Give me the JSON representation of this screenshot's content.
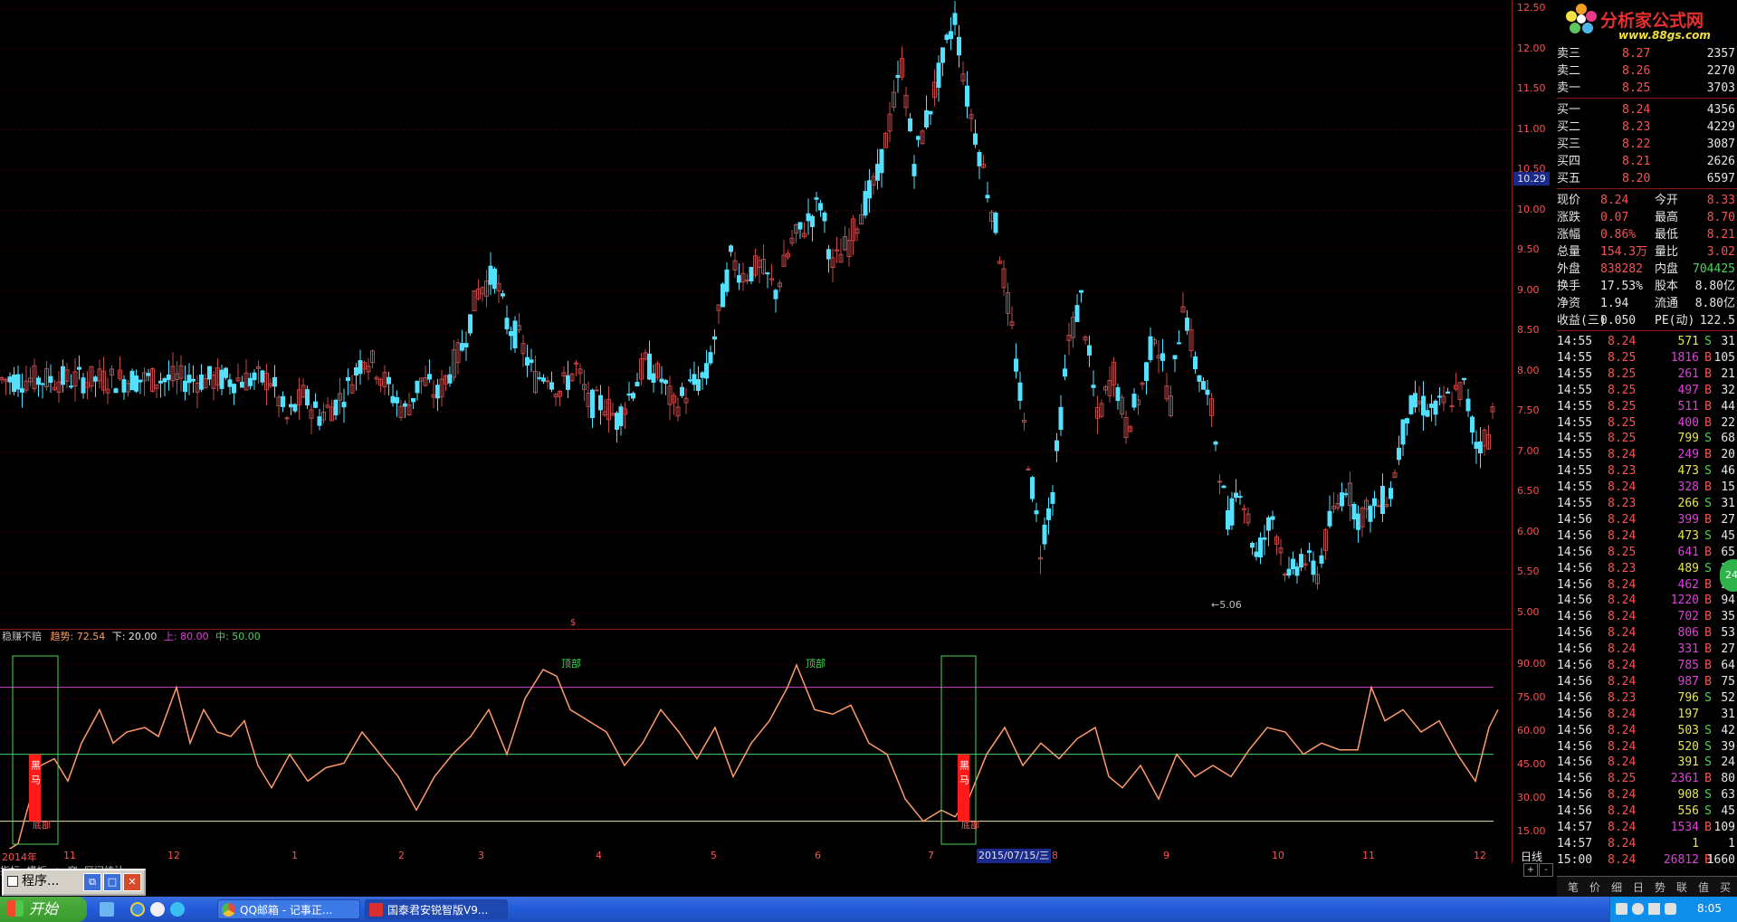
{
  "price_axis": {
    "labels": [
      "12.50",
      "12.00",
      "11.50",
      "11.00",
      "10.50",
      "10.00",
      "9.50",
      "9.00",
      "8.50",
      "8.00",
      "7.50",
      "7.00",
      "6.50",
      "6.00",
      "5.50",
      "5.00"
    ],
    "current_marker": "10.29",
    "min_marker": "5.06"
  },
  "indicator": {
    "name": "稳赚不赔",
    "trend_label": "趋势: 72.54",
    "lower_label": "下: 20.00",
    "upper_label": "上: 80.00",
    "mid_label": "中: 50.00",
    "axis_labels": [
      "90.00",
      "75.00",
      "60.00",
      "45.00",
      "30.00",
      "15.00"
    ],
    "top_tag": "顶部",
    "signal_tag": "黑马",
    "signal_sub": "底部",
    "header_mark": "$"
  },
  "time_axis": {
    "labels": [
      "2014年",
      "11",
      "12",
      "1",
      "2",
      "3",
      "4",
      "5",
      "6",
      "7",
      "8",
      "9",
      "10",
      "11",
      "12"
    ],
    "cursor_date": "2015/07/15/三",
    "period": "日线"
  },
  "status_bar": {
    "items": [
      "指标",
      "模板",
      "∧",
      "窗",
      "区间统计"
    ]
  },
  "logo": {
    "title": "分析家公式网",
    "url": "www.88gs.com"
  },
  "order_book": {
    "asks": [
      {
        "label": "卖三",
        "price": "8.27",
        "vol": "2357"
      },
      {
        "label": "卖二",
        "price": "8.26",
        "vol": "2270"
      },
      {
        "label": "卖一",
        "price": "8.25",
        "vol": "3703"
      }
    ],
    "bids": [
      {
        "label": "买一",
        "price": "8.24",
        "vol": "4356"
      },
      {
        "label": "买二",
        "price": "8.23",
        "vol": "4229"
      },
      {
        "label": "买三",
        "price": "8.22",
        "vol": "3087"
      },
      {
        "label": "买四",
        "price": "8.21",
        "vol": "2626"
      },
      {
        "label": "买五",
        "price": "8.20",
        "vol": "6597"
      }
    ]
  },
  "quote": [
    {
      "l1": "现价",
      "v1": "8.24",
      "l2": "今开",
      "v2": "8.33"
    },
    {
      "l1": "涨跌",
      "v1": "0.07",
      "l2": "最高",
      "v2": "8.70"
    },
    {
      "l1": "涨幅",
      "v1": "0.86%",
      "l2": "最低",
      "v2": "8.21"
    },
    {
      "l1": "总量",
      "v1": "154.3万",
      "l2": "量比",
      "v2": "3.02"
    },
    {
      "l1": "外盘",
      "v1": "838282",
      "l2": "内盘",
      "v2": "704425"
    },
    {
      "l1": "换手",
      "v1": "17.53%",
      "l2": "股本",
      "v2": "8.80亿"
    },
    {
      "l1": "净资",
      "v1": "1.94",
      "l2": "流通",
      "v2": "8.80亿"
    },
    {
      "l1": "收益(三)",
      "v1": "0.050",
      "l2": "PE(动)",
      "v2": "122.5"
    }
  ],
  "ticks": [
    {
      "t": "14:55",
      "p": "8.24",
      "v": "571",
      "d": "S",
      "n": "31"
    },
    {
      "t": "14:55",
      "p": "8.25",
      "v": "1816",
      "d": "B",
      "n": "105"
    },
    {
      "t": "14:55",
      "p": "8.25",
      "v": "261",
      "d": "B",
      "n": "21"
    },
    {
      "t": "14:55",
      "p": "8.25",
      "v": "497",
      "d": "B",
      "n": "32"
    },
    {
      "t": "14:55",
      "p": "8.25",
      "v": "511",
      "d": "B",
      "n": "44"
    },
    {
      "t": "14:55",
      "p": "8.25",
      "v": "400",
      "d": "B",
      "n": "22"
    },
    {
      "t": "14:55",
      "p": "8.25",
      "v": "799",
      "d": "S",
      "n": "68"
    },
    {
      "t": "14:55",
      "p": "8.24",
      "v": "249",
      "d": "B",
      "n": "20"
    },
    {
      "t": "14:55",
      "p": "8.23",
      "v": "473",
      "d": "S",
      "n": "46"
    },
    {
      "t": "14:55",
      "p": "8.24",
      "v": "328",
      "d": "B",
      "n": "15"
    },
    {
      "t": "14:55",
      "p": "8.23",
      "v": "266",
      "d": "S",
      "n": "31"
    },
    {
      "t": "14:56",
      "p": "8.24",
      "v": "399",
      "d": "B",
      "n": "27"
    },
    {
      "t": "14:56",
      "p": "8.24",
      "v": "473",
      "d": "S",
      "n": "45"
    },
    {
      "t": "14:56",
      "p": "8.25",
      "v": "641",
      "d": "B",
      "n": "65"
    },
    {
      "t": "14:56",
      "p": "8.23",
      "v": "489",
      "d": "S",
      "n": "21"
    },
    {
      "t": "14:56",
      "p": "8.24",
      "v": "462",
      "d": "B",
      "n": "24"
    },
    {
      "t": "14:56",
      "p": "8.24",
      "v": "1220",
      "d": "B",
      "n": "94"
    },
    {
      "t": "14:56",
      "p": "8.24",
      "v": "702",
      "d": "B",
      "n": "35"
    },
    {
      "t": "14:56",
      "p": "8.24",
      "v": "806",
      "d": "B",
      "n": "53"
    },
    {
      "t": "14:56",
      "p": "8.24",
      "v": "331",
      "d": "B",
      "n": "27"
    },
    {
      "t": "14:56",
      "p": "8.24",
      "v": "785",
      "d": "B",
      "n": "64"
    },
    {
      "t": "14:56",
      "p": "8.24",
      "v": "987",
      "d": "B",
      "n": "75"
    },
    {
      "t": "14:56",
      "p": "8.23",
      "v": "796",
      "d": "S",
      "n": "52"
    },
    {
      "t": "14:56",
      "p": "8.24",
      "v": "197",
      "d": "",
      "n": "31"
    },
    {
      "t": "14:56",
      "p": "8.24",
      "v": "503",
      "d": "S",
      "n": "42"
    },
    {
      "t": "14:56",
      "p": "8.24",
      "v": "520",
      "d": "S",
      "n": "39"
    },
    {
      "t": "14:56",
      "p": "8.24",
      "v": "391",
      "d": "S",
      "n": "24"
    },
    {
      "t": "14:56",
      "p": "8.25",
      "v": "2361",
      "d": "B",
      "n": "80"
    },
    {
      "t": "14:56",
      "p": "8.24",
      "v": "908",
      "d": "S",
      "n": "63"
    },
    {
      "t": "14:56",
      "p": "8.24",
      "v": "556",
      "d": "S",
      "n": "45"
    },
    {
      "t": "14:57",
      "p": "8.24",
      "v": "1534",
      "d": "B",
      "n": "109"
    },
    {
      "t": "14:57",
      "p": "8.24",
      "v": "1",
      "d": "",
      "n": "1"
    },
    {
      "t": "15:00",
      "p": "8.24",
      "v": "26812",
      "d": "B",
      "n": "1660"
    }
  ],
  "right_tabs": [
    "笔",
    "价",
    "细",
    "日",
    "势",
    "联",
    "值",
    "买"
  ],
  "process_window": {
    "title": "程序..."
  },
  "taskbar": {
    "start": "开始",
    "tasks": [
      "QQ邮箱 - 记事正...",
      "国泰君安锐智版V9..."
    ],
    "clock": "8:05"
  }
}
